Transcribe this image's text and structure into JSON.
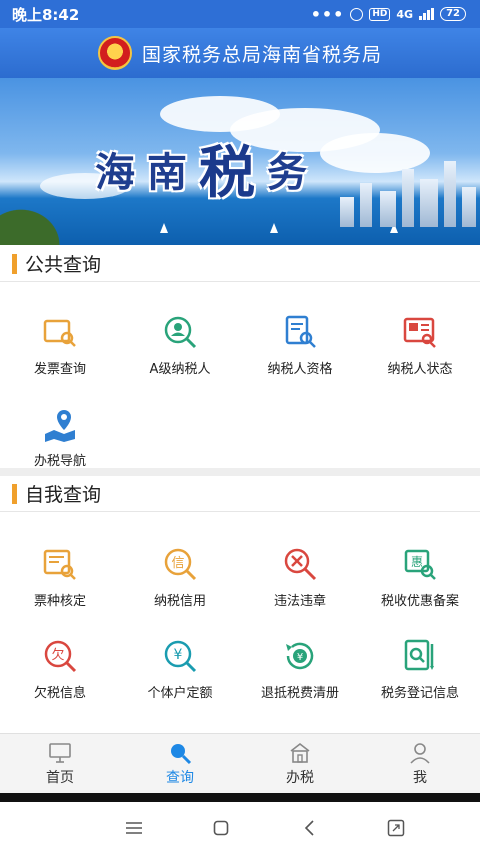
{
  "status_bar": {
    "time": "晚上8:42",
    "hd": "HD",
    "network": "4G",
    "battery": "72"
  },
  "header": {
    "title": "国家税务总局海南省税务局",
    "emblem": "national-emblem"
  },
  "banner": {
    "chars": [
      "海",
      "南",
      "税",
      "务"
    ]
  },
  "public_query": {
    "title": "公共查询",
    "items": [
      {
        "label": "发票查询",
        "icon": "invoice-search-icon",
        "color": "#e8a23a"
      },
      {
        "label": "A级纳税人",
        "icon": "a-level-taxpayer-icon",
        "color": "#29a37a"
      },
      {
        "label": "纳税人资格",
        "icon": "taxpayer-qualification-icon",
        "color": "#2f7fd1"
      },
      {
        "label": "纳税人状态",
        "icon": "taxpayer-status-icon",
        "color": "#d9473f"
      },
      {
        "label": "办税导航",
        "icon": "tax-navigation-icon",
        "color": "#2f7fd1"
      }
    ]
  },
  "self_query": {
    "title": "自我查询",
    "items": [
      {
        "label": "票种核定",
        "icon": "ticket-type-icon",
        "color": "#e8a23a"
      },
      {
        "label": "纳税信用",
        "icon": "tax-credit-icon",
        "color": "#e8a23a"
      },
      {
        "label": "违法违章",
        "icon": "violation-icon",
        "color": "#d9473f"
      },
      {
        "label": "税收优惠备案",
        "icon": "tax-benefit-icon",
        "color": "#29a37a"
      },
      {
        "label": "欠税信息",
        "icon": "tax-arrears-icon",
        "color": "#d9473f"
      },
      {
        "label": "个体户定额",
        "icon": "individual-quota-icon",
        "color": "#1a9cb0"
      },
      {
        "label": "退抵税费清册",
        "icon": "tax-refund-icon",
        "color": "#29a37a"
      },
      {
        "label": "税务登记信息",
        "icon": "tax-registration-icon",
        "color": "#29a37a"
      }
    ]
  },
  "tabbar": {
    "items": [
      {
        "label": "首页",
        "icon": "home-monitor-icon",
        "active": false
      },
      {
        "label": "查询",
        "icon": "search-icon",
        "active": true
      },
      {
        "label": "办税",
        "icon": "tax-office-icon",
        "active": false
      },
      {
        "label": "我",
        "icon": "person-icon",
        "active": false
      }
    ]
  },
  "android_nav": {
    "icons": [
      "menu-icon",
      "home-square-icon",
      "back-icon",
      "screen-expand-icon"
    ]
  }
}
